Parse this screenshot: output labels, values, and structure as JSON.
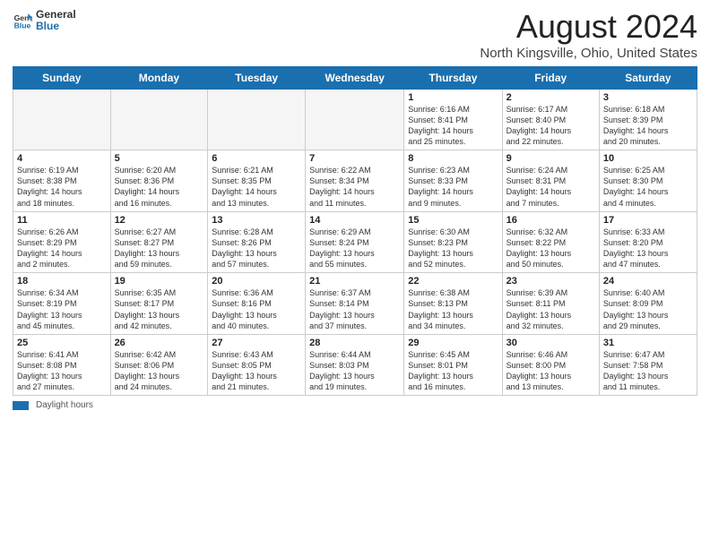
{
  "header": {
    "logo_line1": "General",
    "logo_line2": "Blue",
    "title": "August 2024",
    "subtitle": "North Kingsville, Ohio, United States"
  },
  "columns": [
    "Sunday",
    "Monday",
    "Tuesday",
    "Wednesday",
    "Thursday",
    "Friday",
    "Saturday"
  ],
  "weeks": [
    [
      {
        "day": "",
        "info": ""
      },
      {
        "day": "",
        "info": ""
      },
      {
        "day": "",
        "info": ""
      },
      {
        "day": "",
        "info": ""
      },
      {
        "day": "1",
        "info": "Sunrise: 6:16 AM\nSunset: 8:41 PM\nDaylight: 14 hours\nand 25 minutes."
      },
      {
        "day": "2",
        "info": "Sunrise: 6:17 AM\nSunset: 8:40 PM\nDaylight: 14 hours\nand 22 minutes."
      },
      {
        "day": "3",
        "info": "Sunrise: 6:18 AM\nSunset: 8:39 PM\nDaylight: 14 hours\nand 20 minutes."
      }
    ],
    [
      {
        "day": "4",
        "info": "Sunrise: 6:19 AM\nSunset: 8:38 PM\nDaylight: 14 hours\nand 18 minutes."
      },
      {
        "day": "5",
        "info": "Sunrise: 6:20 AM\nSunset: 8:36 PM\nDaylight: 14 hours\nand 16 minutes."
      },
      {
        "day": "6",
        "info": "Sunrise: 6:21 AM\nSunset: 8:35 PM\nDaylight: 14 hours\nand 13 minutes."
      },
      {
        "day": "7",
        "info": "Sunrise: 6:22 AM\nSunset: 8:34 PM\nDaylight: 14 hours\nand 11 minutes."
      },
      {
        "day": "8",
        "info": "Sunrise: 6:23 AM\nSunset: 8:33 PM\nDaylight: 14 hours\nand 9 minutes."
      },
      {
        "day": "9",
        "info": "Sunrise: 6:24 AM\nSunset: 8:31 PM\nDaylight: 14 hours\nand 7 minutes."
      },
      {
        "day": "10",
        "info": "Sunrise: 6:25 AM\nSunset: 8:30 PM\nDaylight: 14 hours\nand 4 minutes."
      }
    ],
    [
      {
        "day": "11",
        "info": "Sunrise: 6:26 AM\nSunset: 8:29 PM\nDaylight: 14 hours\nand 2 minutes."
      },
      {
        "day": "12",
        "info": "Sunrise: 6:27 AM\nSunset: 8:27 PM\nDaylight: 13 hours\nand 59 minutes."
      },
      {
        "day": "13",
        "info": "Sunrise: 6:28 AM\nSunset: 8:26 PM\nDaylight: 13 hours\nand 57 minutes."
      },
      {
        "day": "14",
        "info": "Sunrise: 6:29 AM\nSunset: 8:24 PM\nDaylight: 13 hours\nand 55 minutes."
      },
      {
        "day": "15",
        "info": "Sunrise: 6:30 AM\nSunset: 8:23 PM\nDaylight: 13 hours\nand 52 minutes."
      },
      {
        "day": "16",
        "info": "Sunrise: 6:32 AM\nSunset: 8:22 PM\nDaylight: 13 hours\nand 50 minutes."
      },
      {
        "day": "17",
        "info": "Sunrise: 6:33 AM\nSunset: 8:20 PM\nDaylight: 13 hours\nand 47 minutes."
      }
    ],
    [
      {
        "day": "18",
        "info": "Sunrise: 6:34 AM\nSunset: 8:19 PM\nDaylight: 13 hours\nand 45 minutes."
      },
      {
        "day": "19",
        "info": "Sunrise: 6:35 AM\nSunset: 8:17 PM\nDaylight: 13 hours\nand 42 minutes."
      },
      {
        "day": "20",
        "info": "Sunrise: 6:36 AM\nSunset: 8:16 PM\nDaylight: 13 hours\nand 40 minutes."
      },
      {
        "day": "21",
        "info": "Sunrise: 6:37 AM\nSunset: 8:14 PM\nDaylight: 13 hours\nand 37 minutes."
      },
      {
        "day": "22",
        "info": "Sunrise: 6:38 AM\nSunset: 8:13 PM\nDaylight: 13 hours\nand 34 minutes."
      },
      {
        "day": "23",
        "info": "Sunrise: 6:39 AM\nSunset: 8:11 PM\nDaylight: 13 hours\nand 32 minutes."
      },
      {
        "day": "24",
        "info": "Sunrise: 6:40 AM\nSunset: 8:09 PM\nDaylight: 13 hours\nand 29 minutes."
      }
    ],
    [
      {
        "day": "25",
        "info": "Sunrise: 6:41 AM\nSunset: 8:08 PM\nDaylight: 13 hours\nand 27 minutes."
      },
      {
        "day": "26",
        "info": "Sunrise: 6:42 AM\nSunset: 8:06 PM\nDaylight: 13 hours\nand 24 minutes."
      },
      {
        "day": "27",
        "info": "Sunrise: 6:43 AM\nSunset: 8:05 PM\nDaylight: 13 hours\nand 21 minutes."
      },
      {
        "day": "28",
        "info": "Sunrise: 6:44 AM\nSunset: 8:03 PM\nDaylight: 13 hours\nand 19 minutes."
      },
      {
        "day": "29",
        "info": "Sunrise: 6:45 AM\nSunset: 8:01 PM\nDaylight: 13 hours\nand 16 minutes."
      },
      {
        "day": "30",
        "info": "Sunrise: 6:46 AM\nSunset: 8:00 PM\nDaylight: 13 hours\nand 13 minutes."
      },
      {
        "day": "31",
        "info": "Sunrise: 6:47 AM\nSunset: 7:58 PM\nDaylight: 13 hours\nand 11 minutes."
      }
    ]
  ],
  "footer": {
    "daylight_label": "Daylight hours"
  }
}
